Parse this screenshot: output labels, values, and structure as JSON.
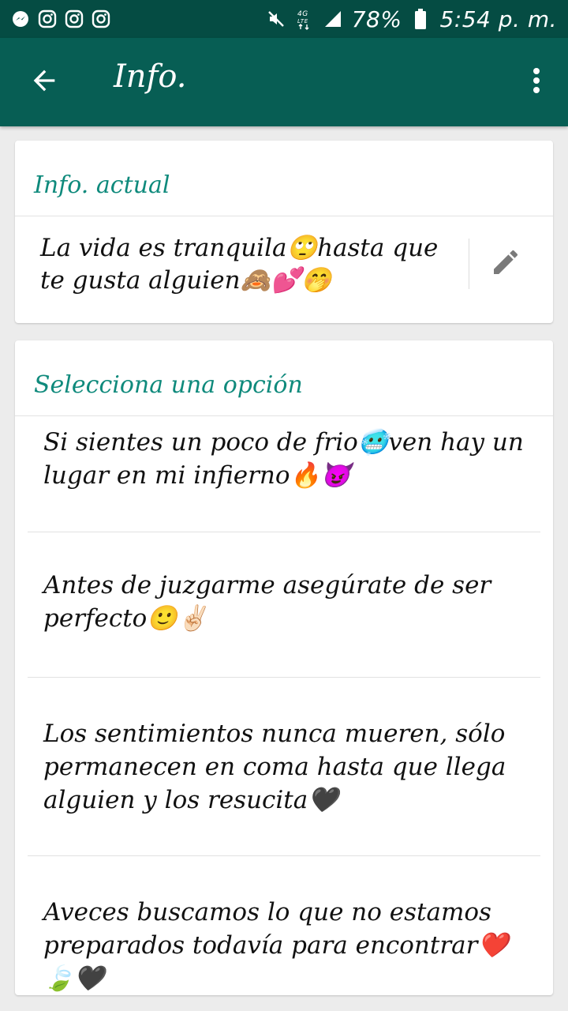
{
  "status_bar": {
    "left_icons": [
      "messenger-icon",
      "instagram-icon",
      "instagram-icon",
      "instagram-icon"
    ],
    "right_icons": [
      "mute-icon",
      "lte-icon",
      "signal-icon"
    ],
    "battery": "78%",
    "time": "5:54 p. m."
  },
  "toolbar": {
    "title": "Info.",
    "back_icon": "arrow-left-icon",
    "menu_icon": "more-vert-icon",
    "color": "#075e54"
  },
  "current_about": {
    "header": "Info. actual",
    "text": "La vida es tranquila🙄hasta que te gusta alguien🙈💕🤭",
    "edit_icon": "pencil-icon"
  },
  "options": {
    "header": "Selecciona una opción",
    "items": [
      "Si sientes un poco de frio🥶ven hay un lugar en mi infierno🔥😈",
      "Antes de juzgarme asegúrate de ser perfecto🙂✌🏻",
      "Los sentimientos nunca mueren, sólo permanecen en coma hasta que llega alguien y los resucita🖤",
      "Aveces buscamos lo que no estamos preparados todavía para encontrar❤️🍃🖤"
    ]
  },
  "colors": {
    "accent": "#0f8a7c",
    "status_bar": "#054c43"
  }
}
